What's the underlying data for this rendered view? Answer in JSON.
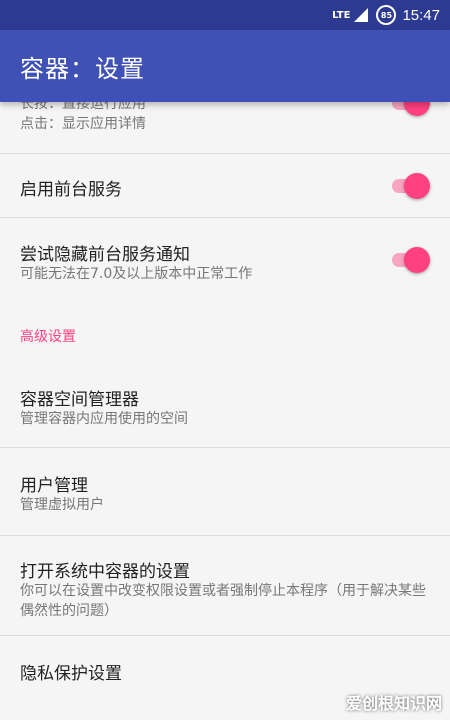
{
  "status_bar": {
    "network": "LTE",
    "battery": "85",
    "time": "15:47"
  },
  "app_bar": {
    "title": "容器：设置"
  },
  "settings": {
    "partial_item": {
      "line1": "长按：直接运行应用",
      "line2": "点击：显示应用详情",
      "enabled": true
    },
    "foreground_service": {
      "title": "启用前台服务",
      "enabled": true
    },
    "hide_notification": {
      "title": "尝试隐藏前台服务通知",
      "subtitle": "可能无法在7.0及以上版本中正常工作",
      "enabled": true
    },
    "advanced_header": "高级设置",
    "space_manager": {
      "title": "容器空间管理器",
      "subtitle": "管理容器内应用使用的空间"
    },
    "user_management": {
      "title": "用户管理",
      "subtitle": "管理虚拟用户"
    },
    "system_settings": {
      "title": "打开系统中容器的设置",
      "subtitle": "你可以在设置中改变权限设置或者强制停止本程序（用于解决某些偶然性的问题）"
    },
    "privacy": {
      "title": "隐私保护设置"
    }
  },
  "watermark": "爱创根知识网",
  "colors": {
    "status_bar": "#2c3a91",
    "app_bar": "#3f51b5",
    "accent": "#ff4081"
  }
}
